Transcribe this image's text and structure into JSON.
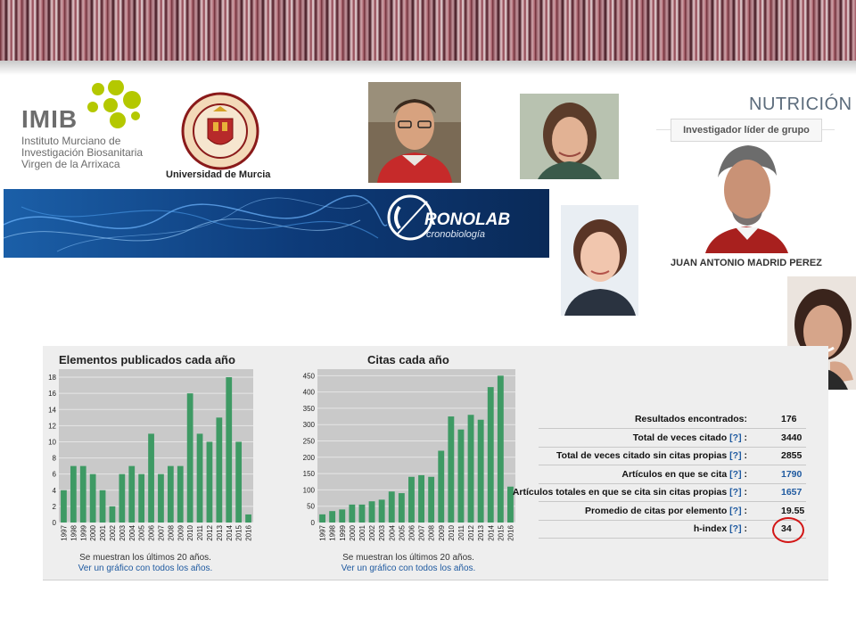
{
  "header": {
    "imib": {
      "acronym": "IMIB",
      "lines": [
        "Instituto Murciano de",
        "Investigación Biosanitaria",
        "Virgen de la Arrixaca"
      ]
    },
    "um_name": "Universidad de Murcia"
  },
  "group": {
    "title": "NUTRICIÓN",
    "lead_label": "Investigador líder de grupo",
    "lead_name": "JUAN ANTONIO MADRID PEREZ"
  },
  "cronolab": {
    "logo_text": "RONOLAB",
    "subtitle": "cronobiología"
  },
  "publications_chart": {
    "title": "Elementos publicados cada año",
    "note": "Se muestran los últimos 20 años.",
    "link": "Ver un gráfico con todos los años."
  },
  "citations_chart": {
    "title": "Citas cada año",
    "note": "Se muestran los últimos 20 años.",
    "link": "Ver un gráfico con todos los años."
  },
  "stats": [
    {
      "label": "Resultados encontrados:",
      "help": "",
      "value": "176"
    },
    {
      "label": "Total de veces citado",
      "help": "[?]",
      "value": "3440"
    },
    {
      "label": "Total de veces citado sin citas propias",
      "help": "[?]",
      "value": "2855"
    },
    {
      "label": "Artículos en que se cita",
      "help": "[?]",
      "value": "1790"
    },
    {
      "label": "Artículos totales en que se cita sin citas propias",
      "help": "[?]",
      "value": "1657"
    },
    {
      "label": "Promedio de citas por elemento",
      "help": "[?]",
      "value": "19.55"
    },
    {
      "label": "h-index",
      "help": "[?]",
      "value": "34"
    }
  ],
  "chart_data": [
    {
      "type": "bar",
      "title": "Elementos publicados cada año",
      "categories": [
        "1997",
        "1998",
        "1999",
        "2000",
        "2001",
        "2002",
        "2003",
        "2004",
        "2005",
        "2006",
        "2007",
        "2008",
        "2009",
        "2010",
        "2011",
        "2012",
        "2013",
        "2014",
        "2015",
        "2016"
      ],
      "values": [
        4,
        7,
        7,
        6,
        4,
        2,
        6,
        7,
        6,
        11,
        6,
        7,
        7,
        16,
        11,
        10,
        13,
        18,
        10,
        1
      ],
      "yticks": [
        0,
        2,
        4,
        6,
        8,
        10,
        12,
        14,
        16,
        18
      ],
      "ylim": [
        0,
        19
      ],
      "color": "#3e9a64",
      "grid": true
    },
    {
      "type": "bar",
      "title": "Citas cada año",
      "categories": [
        "1997",
        "1998",
        "1999",
        "2000",
        "2001",
        "2002",
        "2003",
        "2004",
        "2005",
        "2006",
        "2007",
        "2008",
        "2009",
        "2010",
        "2011",
        "2012",
        "2013",
        "2014",
        "2015",
        "2016"
      ],
      "values": [
        25,
        35,
        40,
        55,
        55,
        65,
        70,
        95,
        90,
        140,
        145,
        140,
        220,
        325,
        285,
        330,
        315,
        415,
        450,
        110
      ],
      "yticks": [
        0,
        50,
        100,
        150,
        200,
        250,
        300,
        350,
        400,
        450
      ],
      "ylim": [
        0,
        470
      ],
      "color": "#3e9a64",
      "grid": true
    }
  ]
}
